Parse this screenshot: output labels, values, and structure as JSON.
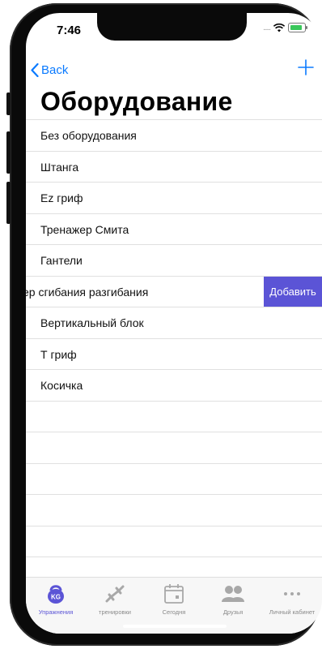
{
  "status": {
    "time": "7:46",
    "signal_dots": "....."
  },
  "nav": {
    "back_label": "Back",
    "add_icon": "plus-icon"
  },
  "title": "Оборудование",
  "equipment": [
    "Без оборудования",
    "Штанга",
    "Ez гриф",
    "Тренажер Смита",
    "Гантели",
    "ер сгибания разгибания",
    "Вертикальный блок",
    "Т гриф",
    "Косичка"
  ],
  "swipe_action": {
    "label": "Добавить",
    "color": "#5b54d6"
  },
  "tabs": [
    {
      "label": "Упражнения",
      "icon": "kettlebell-icon",
      "active": true
    },
    {
      "label": "тренировки",
      "icon": "dumbbell-icon",
      "active": false
    },
    {
      "label": "Сегодня",
      "icon": "calendar-icon",
      "active": false
    },
    {
      "label": "Друзья",
      "icon": "friends-icon",
      "active": false
    },
    {
      "label": "Личный кабинет",
      "icon": "more-icon",
      "active": false
    }
  ],
  "colors": {
    "accent": "#0a7aff",
    "tab_active": "#5b54d6",
    "tab_inactive": "#8a8a8a"
  }
}
